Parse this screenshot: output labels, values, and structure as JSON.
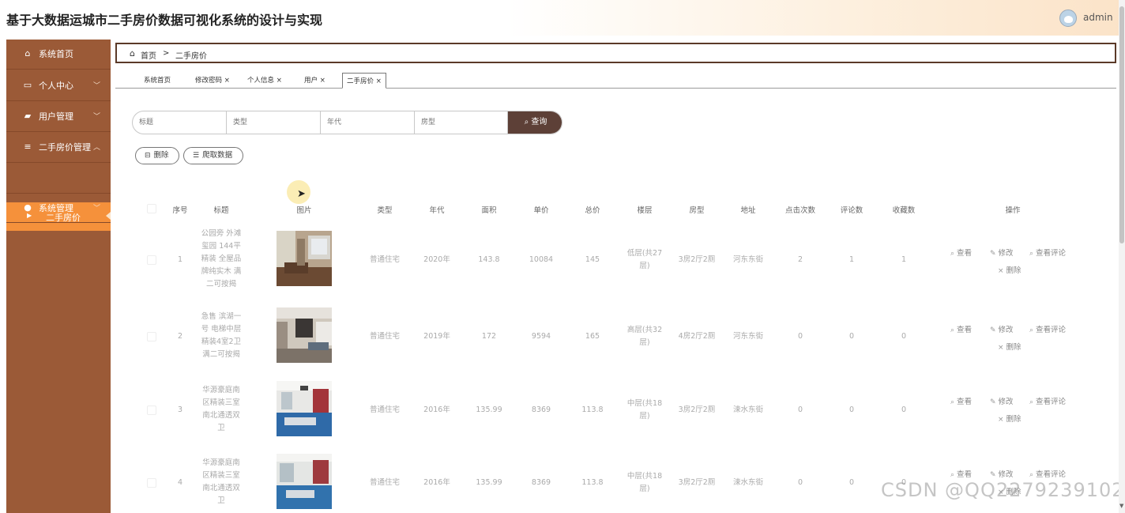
{
  "header": {
    "title": "基于大数据运城市二手房价数据可视化系统的设计与实现",
    "username": "admin"
  },
  "sidebar": {
    "items": [
      {
        "label": "系统首页",
        "icon": "home-icon"
      },
      {
        "label": "个人中心",
        "icon": "id-card-icon"
      },
      {
        "label": "用户管理",
        "icon": "chat-icon"
      },
      {
        "label": "二手房价管理",
        "icon": "list-icon"
      },
      {
        "label": "系统管理",
        "icon": "user-icon"
      }
    ],
    "active_sub": "二手房价"
  },
  "breadcrumb": {
    "home": "首页",
    "separator": ">",
    "current": "二手房价"
  },
  "tabs": [
    "系统首页",
    "修改密码",
    "个人信息",
    "用户",
    "二手房价"
  ],
  "search": {
    "placeholders": {
      "title": "标题",
      "type": "类型",
      "year": "年代",
      "layout": "房型"
    },
    "button": "查询"
  },
  "actions": {
    "delete": "删除",
    "crawl": "爬取数据"
  },
  "table": {
    "headers": [
      "序号",
      "标题",
      "图片",
      "类型",
      "年代",
      "面积",
      "单价",
      "总价",
      "楼层",
      "房型",
      "地址",
      "点击次数",
      "评论数",
      "收藏数",
      "操作"
    ],
    "rows": [
      {
        "no": "1",
        "title": "公园旁 外滩玺园 144平精装 全屋品牌纯实木 满二可按揭",
        "type": "普通住宅",
        "year": "2020年",
        "area": "143.8",
        "unit_price": "10084",
        "total": "145",
        "floor": "低层(共27层)",
        "layout": "3房2厅2厕",
        "address": "河东东街",
        "clicks": "2",
        "comments": "1",
        "favorites": "1"
      },
      {
        "no": "2",
        "title": "急售 滨湖一号 电梯中层 精装4室2卫 满二可按揭",
        "type": "普通住宅",
        "year": "2019年",
        "area": "172",
        "unit_price": "9594",
        "total": "165",
        "floor": "高层(共32层)",
        "layout": "4房2厅2厕",
        "address": "河东东街",
        "clicks": "0",
        "comments": "0",
        "favorites": "0"
      },
      {
        "no": "3",
        "title": "华源豪庭南区精装三室南北通透双卫",
        "type": "普通住宅",
        "year": "2016年",
        "area": "135.99",
        "unit_price": "8369",
        "total": "113.8",
        "floor": "中层(共18层)",
        "layout": "3房2厅2厕",
        "address": "涑水东街",
        "clicks": "0",
        "comments": "0",
        "favorites": "0"
      },
      {
        "no": "4",
        "title": "华源豪庭南区精装三室南北通透双卫",
        "type": "普通住宅",
        "year": "2016年",
        "area": "135.99",
        "unit_price": "8369",
        "total": "113.8",
        "floor": "中层(共18层)",
        "layout": "3房2厅2厕",
        "address": "涑水东街",
        "clicks": "0",
        "comments": "0",
        "favorites": "0"
      }
    ],
    "ops": {
      "view": "查看",
      "edit": "修改",
      "view_comments": "查看评论",
      "delete": "删除"
    }
  },
  "watermark": "CSDN @QQ2279239102",
  "colors": {
    "sidebar": "#9b5a37",
    "sidebar_active": "#f5913b",
    "search_button": "#5d4037",
    "breadcrumb_border": "#5b3a28"
  }
}
